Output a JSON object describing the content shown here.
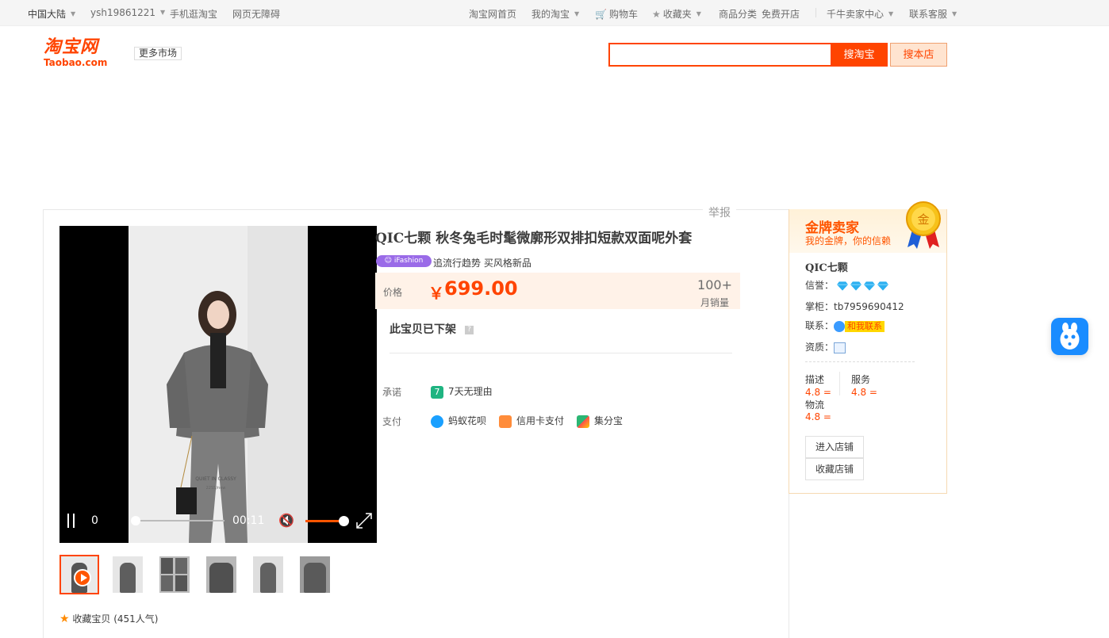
{
  "topbar": {
    "region": "中国大陆",
    "username": "ysh19861221",
    "mobile": "手机逛淘宝",
    "accessible": "网页无障碍",
    "home": "淘宝网首页",
    "my_taobao": "我的淘宝",
    "cart": "购物车",
    "favorites": "收藏夹",
    "categories": "商品分类",
    "open_store": "免费开店",
    "seller_center": "千牛卖家中心",
    "customer_service": "联系客服"
  },
  "header": {
    "logo_cn": "淘宝网",
    "logo_en": "Taobao.com",
    "more_markets": "更多市场",
    "search_value": "",
    "search_taobao": "搜淘宝",
    "search_store": "搜本店"
  },
  "report": "举报",
  "video": {
    "current_time": "0",
    "duration": "00:11",
    "poster_caption_1": "QUIET IN CLASSY",
    "poster_caption_2": "22SS/new",
    "progress": 0.0,
    "volume": 0.0
  },
  "thumbnails": [
    {
      "label": "video"
    },
    {
      "label": "photo-1"
    },
    {
      "label": "photo-2"
    },
    {
      "label": "photo-3"
    },
    {
      "label": "photo-4"
    },
    {
      "label": "photo-5"
    }
  ],
  "product": {
    "title": "QIC七颗 秋冬兔毛时髦微廓形双排扣短款双面呢外套",
    "badge": "iFashion",
    "subtitle": "追流行趋势 买风格新品",
    "price_label": "价格",
    "price_symbol": "￥",
    "price": "699.00",
    "sales_count": "100+",
    "sales_label": "月销量",
    "delisted": "此宝贝已下架",
    "delisted_help": "?",
    "promise_label": "承诺",
    "promise_value": "7天无理由",
    "pay_label": "支付",
    "pay_methods": [
      "蚂蚁花呗",
      "信用卡支付",
      "集分宝"
    ],
    "favorite": "收藏宝贝 (451人气)"
  },
  "seller": {
    "title": "金牌卖家",
    "subtitle": "我的金牌，你的信赖",
    "medal_text": "金",
    "shop_name": "QIC七颗",
    "credit_label": "信誉：",
    "credit_diamonds": 4,
    "keeper_label": "掌柜：",
    "keeper": "tb7959690412",
    "contact_label": "联系：",
    "contact_button": "和我联系",
    "qualification_label": "资质：",
    "scores": [
      {
        "label": "描述",
        "value": "4.8 ="
      },
      {
        "label": "服务",
        "value": "4.8 ="
      },
      {
        "label": "物流",
        "value": "4.8 ="
      }
    ],
    "enter_store": "进入店铺",
    "favorite_store": "收藏店铺"
  },
  "colors": {
    "accent": "#ff4400",
    "gold": "#ff5500",
    "badge": "#9a6be8",
    "robot": "#1a8cff"
  }
}
